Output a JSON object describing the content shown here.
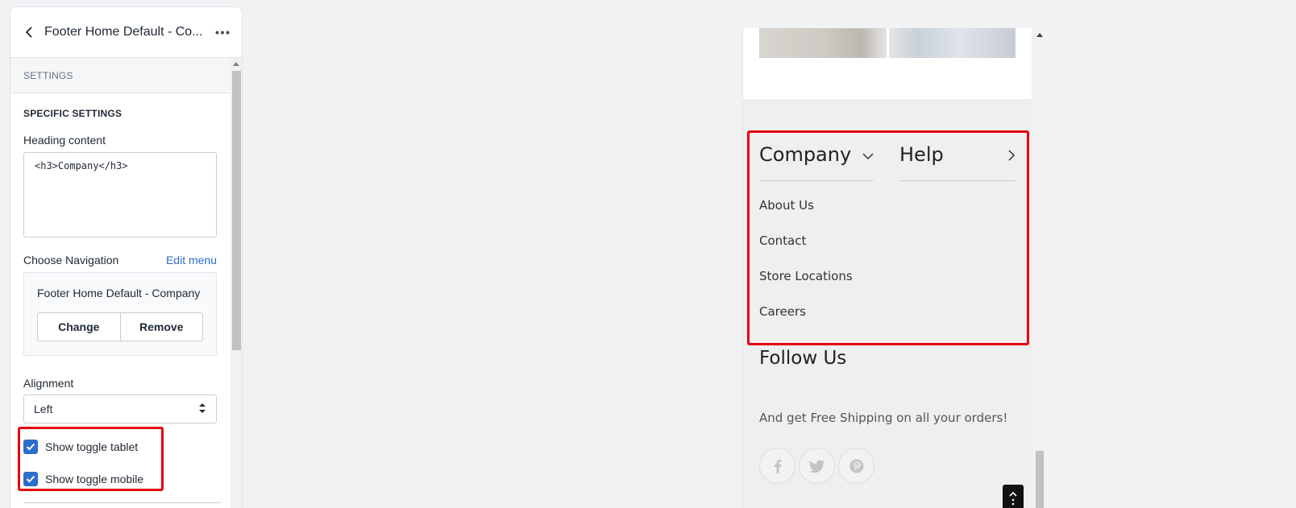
{
  "editor": {
    "title": "Footer Home Default - Co...",
    "section_label": "SETTINGS",
    "specific_label": "SPECIFIC SETTINGS",
    "heading_label": "Heading content",
    "heading_value": "<h3>Company</h3>",
    "nav_label": "Choose Navigation",
    "edit_menu": "Edit menu",
    "nav_selected": "Footer Home Default - Company",
    "change_btn": "Change",
    "remove_btn": "Remove",
    "alignment_label": "Alignment",
    "alignment_value": "Left",
    "toggle_tablet": "Show toggle tablet",
    "toggle_mobile": "Show toggle mobile",
    "toggle_tablet_checked": true,
    "toggle_mobile_checked": true
  },
  "preview": {
    "col1_title": "Company",
    "col2_title": "Help",
    "links": [
      "About Us",
      "Contact",
      "Store Locations",
      "Careers"
    ],
    "follow_title": "Follow Us",
    "tagline": "And get Free Shipping on all your orders!",
    "social": [
      "facebook-icon",
      "twitter-icon",
      "pinterest-icon"
    ]
  },
  "colors": {
    "accent": "#2c6ecb",
    "highlight": "#e3000f"
  }
}
